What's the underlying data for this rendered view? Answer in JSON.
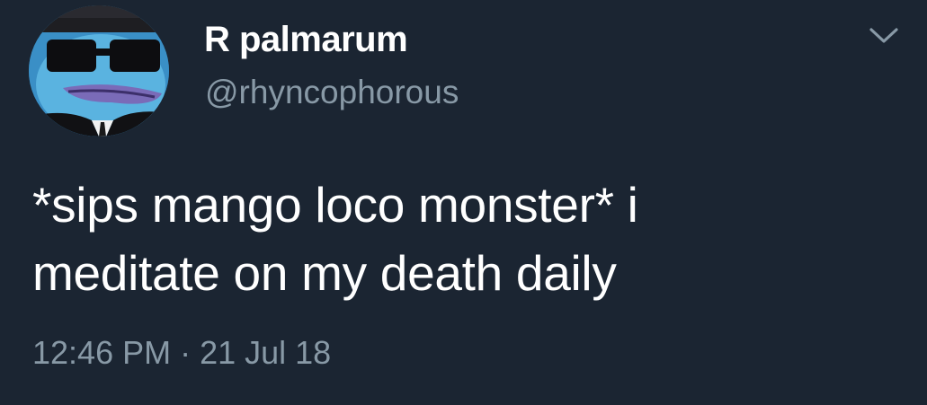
{
  "user": {
    "display_name": "R palmarum",
    "handle": "@rhyncophorous",
    "avatar_icon": "avatar-cartoon-frog-sunglasses-icon"
  },
  "menu": {
    "icon": "chevron-down-icon"
  },
  "tweet": {
    "line1": "*sips mango loco monster* i",
    "line2": "meditate on my death daily",
    "time": "12:46 PM",
    "separator": "·",
    "date": "21 Jul 18"
  },
  "colors": {
    "background": "#1b2532",
    "text_primary": "#ffffff",
    "text_secondary": "#8899a6"
  }
}
